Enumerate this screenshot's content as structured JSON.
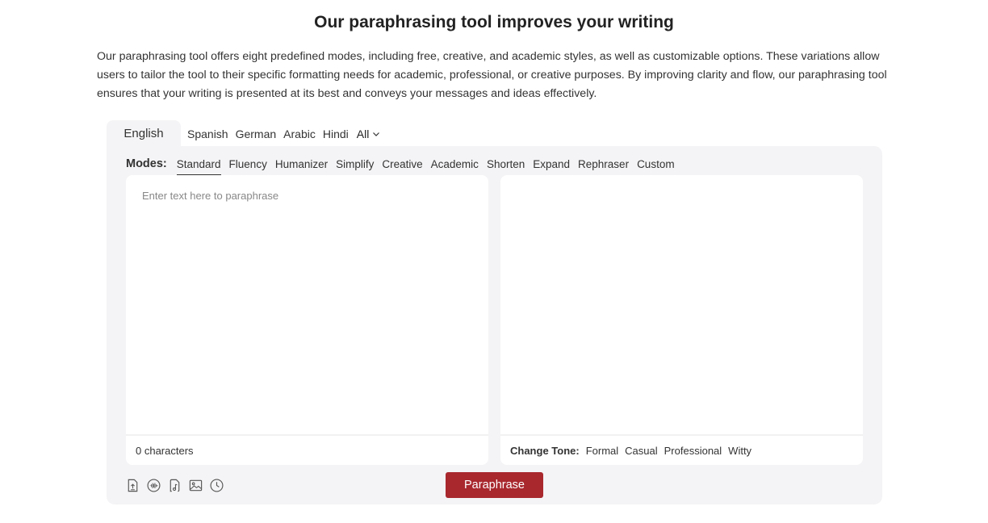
{
  "header": {
    "title": "Our paraphrasing tool improves your writing",
    "description": "Our paraphrasing tool offers eight predefined modes, including free, creative, and academic styles, as well as customizable options. These variations allow users to tailor the tool to their specific formatting needs for academic, professional, or creative purposes. By improving clarity and flow, our paraphrasing tool ensures that your writing is presented at its best and conveys your messages and ideas effectively."
  },
  "languages": {
    "active": "English",
    "items": [
      "Spanish",
      "German",
      "Arabic",
      "Hindi"
    ],
    "all_label": "All"
  },
  "modes": {
    "label": "Modes:",
    "items": [
      "Standard",
      "Fluency",
      "Humanizer",
      "Simplify",
      "Creative",
      "Academic",
      "Shorten",
      "Expand",
      "Rephraser",
      "Custom"
    ],
    "active": "Standard"
  },
  "input": {
    "placeholder": "Enter text here to paraphrase",
    "char_count": "0 characters"
  },
  "output": {
    "tone_label": "Change Tone:",
    "tones": [
      "Formal",
      "Casual",
      "Professional",
      "Witty"
    ]
  },
  "tools": [
    "upload-file-icon",
    "audio-icon",
    "music-file-icon",
    "image-icon",
    "history-icon"
  ],
  "action": {
    "paraphrase_label": "Paraphrase",
    "button_color": "#a8282e"
  }
}
